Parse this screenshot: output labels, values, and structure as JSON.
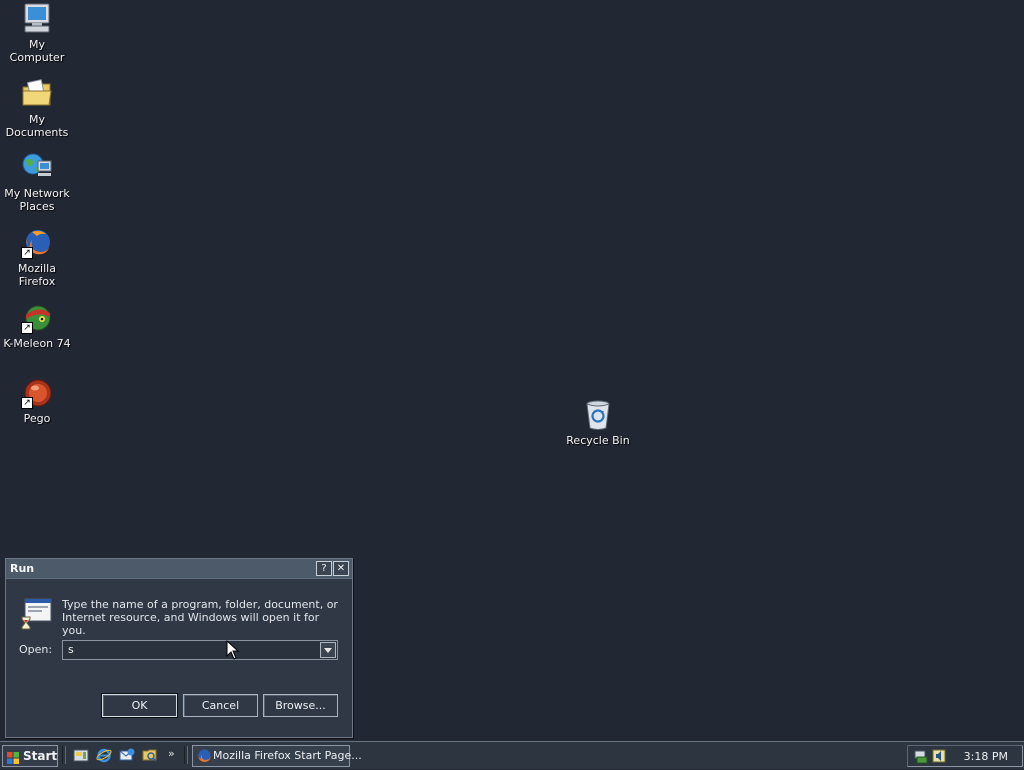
{
  "desktop": {
    "icons": [
      {
        "label": "My Computer",
        "icon": "computer-icon"
      },
      {
        "label": "My Documents",
        "icon": "folder-documents-icon"
      },
      {
        "label": "My Network Places",
        "icon": "network-places-icon"
      },
      {
        "label": "Mozilla Firefox",
        "icon": "firefox-icon"
      },
      {
        "label": "K-Meleon 74",
        "icon": "k-meleon-icon"
      },
      {
        "label": "Pego",
        "icon": "pego-icon"
      },
      {
        "label": "Recycle Bin",
        "icon": "recycle-bin-icon"
      }
    ]
  },
  "run_dialog": {
    "title": "Run",
    "help_label": "?",
    "close_label": "✕",
    "description": "Type the name of a program, folder, document, or Internet resource, and Windows will open it for you.",
    "open_label": "Open:",
    "open_value": "s",
    "ok_label": "OK",
    "cancel_label": "Cancel",
    "browse_label": "Browse..."
  },
  "taskbar": {
    "start_label": "Start",
    "quick_launch": [
      "show-desktop-icon",
      "internet-explorer-icon",
      "outlook-express-icon",
      "windows-explorer-icon"
    ],
    "overflow_label": "»",
    "tasks": [
      {
        "label": "Mozilla Firefox Start Page...",
        "icon": "firefox-icon"
      }
    ],
    "tray_icons": [
      "network-tray-icon",
      "volume-tray-icon"
    ],
    "clock": "3:18 PM"
  },
  "colors": {
    "desktop_bg": "#222833",
    "dialog_bg": "#2f3844",
    "titlebar_bg": "#4d5a6a",
    "taskbar_bg": "#2d3540"
  }
}
